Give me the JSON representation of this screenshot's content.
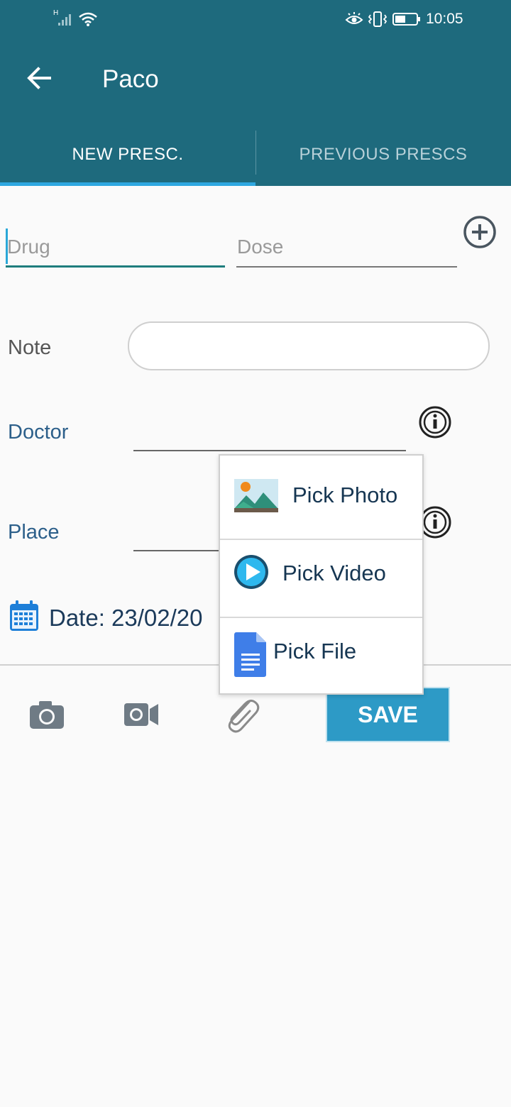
{
  "status_bar": {
    "network": "H",
    "time": "10:05"
  },
  "toolbar": {
    "title": "Paco",
    "back_icon": "arrow-left-icon"
  },
  "tabs": [
    {
      "label": "NEW PRESC.",
      "active": true
    },
    {
      "label": "PREVIOUS PRESCS",
      "active": false
    }
  ],
  "form": {
    "drug_placeholder": "Drug",
    "dose_placeholder": "Dose",
    "note_label": "Note",
    "doctor_label": "Doctor",
    "place_label": "Place",
    "date_text": "Date: 23/02/20"
  },
  "attach_menu": {
    "items": [
      {
        "label": "Pick Photo",
        "icon": "image-icon"
      },
      {
        "label": "Pick Video",
        "icon": "play-icon"
      },
      {
        "label": "Pick File",
        "icon": "document-icon"
      }
    ]
  },
  "actions": {
    "save_label": "SAVE"
  },
  "colors": {
    "header": "#1e6a7d",
    "accent": "#2ea7e0",
    "save_button": "#2d9ac6"
  }
}
